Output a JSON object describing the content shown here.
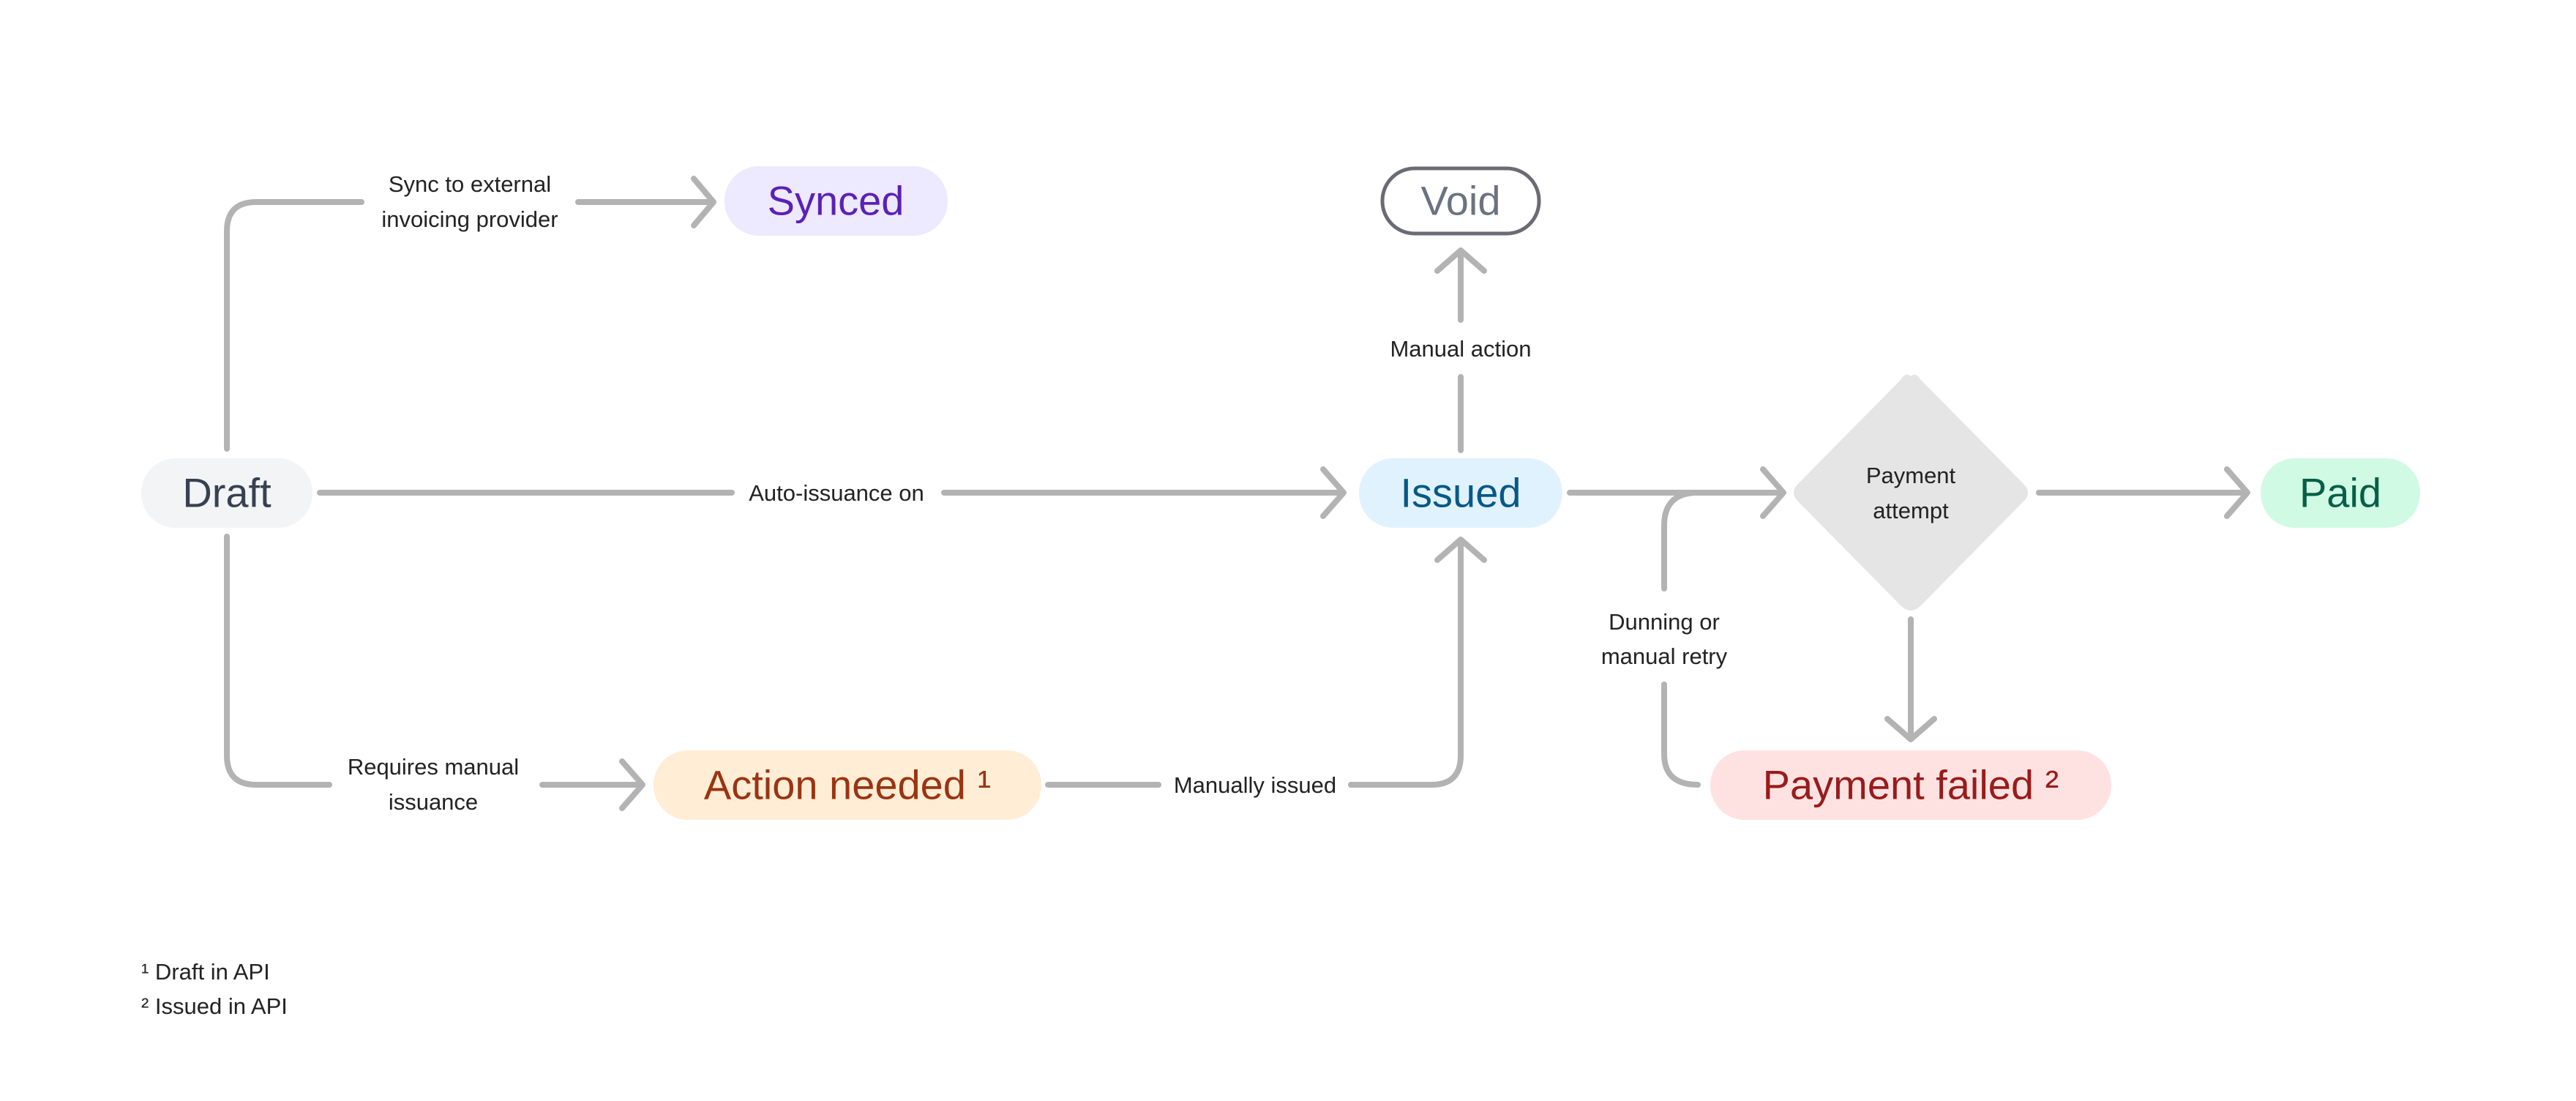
{
  "nodes": {
    "draft": {
      "label": "Draft",
      "bg": "#f3f4f6",
      "fg": "#374151"
    },
    "synced": {
      "label": "Synced",
      "bg": "#ede9fe",
      "fg": "#5b21b6"
    },
    "void": {
      "label": "Void",
      "bg": "#ffffff",
      "fg": "#6b7280",
      "border": "#6b6b75"
    },
    "issued": {
      "label": "Issued",
      "bg": "#e0f2fe",
      "fg": "#075985"
    },
    "payment_attempt": {
      "label_line1": "Payment",
      "label_line2": "attempt",
      "bg": "#e5e5e5"
    },
    "paid": {
      "label": "Paid",
      "bg": "#d1fae5",
      "fg": "#065f46"
    },
    "action_needed": {
      "label": "Action needed ¹",
      "bg": "#ffedd5",
      "fg": "#9a3412"
    },
    "payment_failed": {
      "label": "Payment failed ²",
      "bg": "#fee2e2",
      "fg": "#991b1b"
    }
  },
  "edges": {
    "sync": {
      "line1": "Sync to external",
      "line2": "invoicing provider"
    },
    "auto_issuance": {
      "label": "Auto-issuance on"
    },
    "requires_manual": {
      "line1": "Requires manual",
      "line2": "issuance"
    },
    "manually_issued": {
      "label": "Manually issued"
    },
    "manual_action": {
      "label": "Manual action"
    },
    "dunning": {
      "line1": "Dunning or",
      "line2": "manual retry"
    }
  },
  "footnotes": [
    "¹ Draft in API",
    "² Issued in API"
  ],
  "edge_color": "#b3b3b3"
}
